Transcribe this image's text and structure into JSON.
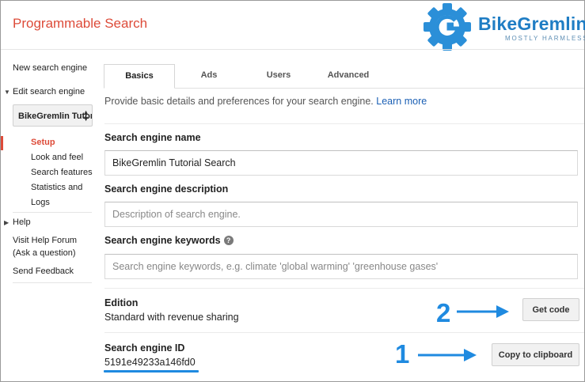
{
  "app": {
    "title": "Programmable Search"
  },
  "logo": {
    "name": "BikeGremlin",
    "tagline": "MOSTLY HARMLESS ™"
  },
  "sidebar": {
    "new_engine": "New search engine",
    "edit_engine": "Edit search engine",
    "engine_select": "BikeGremlin Tutorial Search",
    "sub_items": [
      "Setup",
      "Look and feel",
      "Search features",
      "Statistics and",
      "Logs"
    ],
    "active_item": "Setup",
    "help": "Help",
    "forum_line1": "Visit Help Forum",
    "forum_line2": "(Ask a question)",
    "feedback": "Send Feedback"
  },
  "tabs": [
    {
      "label": "Basics",
      "active": true
    },
    {
      "label": "Ads",
      "active": false
    },
    {
      "label": "Users",
      "active": false
    },
    {
      "label": "Advanced",
      "active": false
    }
  ],
  "basics": {
    "description": "Provide basic details and preferences for your search engine.",
    "learn_more": "Learn more",
    "name_label": "Search engine name",
    "name_value": "BikeGremlin Tutorial Search",
    "desc_label": "Search engine description",
    "desc_placeholder": "Description of search engine.",
    "keywords_label": "Search engine keywords",
    "keywords_help": "?",
    "keywords_placeholder": "Search engine keywords, e.g. climate 'global warming' 'greenhouse gases'",
    "edition_label": "Edition",
    "edition_value": "Standard with revenue sharing",
    "get_code": "Get code",
    "id_label": "Search engine ID",
    "id_value": "5191e49233a146fd0",
    "copy": "Copy to clipboard"
  },
  "callouts": {
    "one": "1",
    "two": "2"
  },
  "colors": {
    "accent_red": "#dd4b39",
    "link_blue": "#1a5fb4",
    "callout_blue": "#1f8ae0"
  }
}
